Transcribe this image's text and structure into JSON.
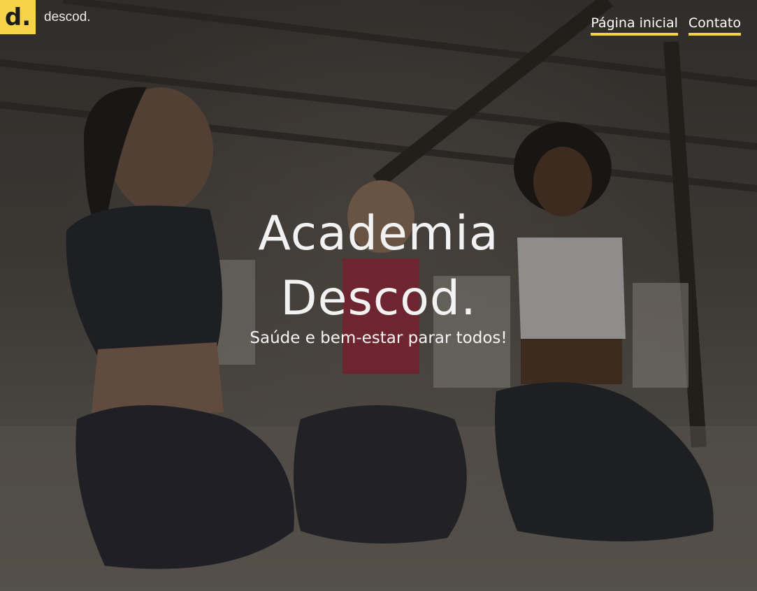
{
  "header": {
    "logo_glyph": "d.",
    "brand": "descod.",
    "nav": [
      "Página inicial",
      "Contato"
    ]
  },
  "hero": {
    "title_line1": "Academia",
    "title_line2": "Descod.",
    "subtitle": "Saúde e bem-estar parar todos!",
    "image_icon": "fitness-photo"
  },
  "colors": {
    "accent": "#f7d34a",
    "text": "#f2f2f2"
  }
}
